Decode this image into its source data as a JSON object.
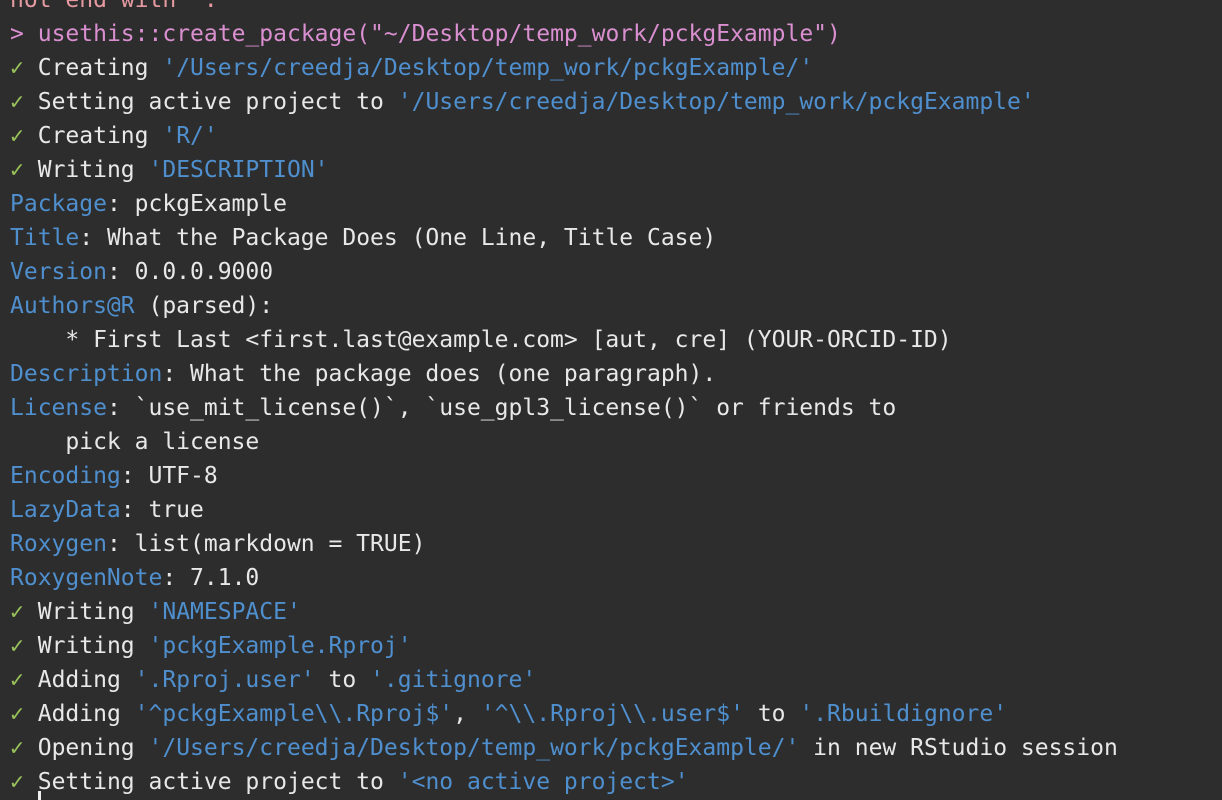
{
  "colors": {
    "background": "#2d2d2d",
    "text": "#e8e8e8",
    "command": "#d98fd0",
    "checkmark": "#98c15a",
    "highlight": "#4f8fce"
  },
  "console": {
    "top_partial": "not end with '.",
    "prompt": ">",
    "command": "usethis::create_package(\"~/Desktop/temp_work/pckgExample\")",
    "check_mark": "✓",
    "lines": {
      "l1_text": "Creating ",
      "l1_path": "'/Users/creedja/Desktop/temp_work/pckgExample/'",
      "l2_text": "Setting active project to ",
      "l2_path": "'/Users/creedja/Desktop/temp_work/pckgExample'",
      "l3_text": "Creating ",
      "l3_path": "'R/'",
      "l4_text": "Writing ",
      "l4_path": "'DESCRIPTION'",
      "pkg_key": "Package",
      "pkg_val": ": pckgExample",
      "title_key": "Title",
      "title_val": ": What the Package Does (One Line, Title Case)",
      "version_key": "Version",
      "version_val": ": 0.0.0.9000",
      "authors_key": "Authors@R",
      "authors_val": " (parsed):",
      "author_entry": "    * First Last <first.last@example.com> [aut, cre] (YOUR-ORCID-ID)",
      "desc_key": "Description",
      "desc_val": ": What the package does (one paragraph).",
      "license_key": "License",
      "license_val": ": `use_mit_license()`, `use_gpl3_license()` or friends to",
      "license_cont": "    pick a license",
      "encoding_key": "Encoding",
      "encoding_val": ": UTF-8",
      "lazy_key": "LazyData",
      "lazy_val": ": true",
      "roxygen_key": "Roxygen",
      "roxygen_val": ": list(markdown = TRUE)",
      "roxynote_key": "RoxygenNote",
      "roxynote_val": ": 7.1.0",
      "l5_text": "Writing ",
      "l5_path": "'NAMESPACE'",
      "l6_text": "Writing ",
      "l6_path": "'pckgExample.Rproj'",
      "l7_text": "Adding ",
      "l7_path": "'.Rproj.user'",
      "l7_to": " to ",
      "l7_target": "'.gitignore'",
      "l8_text": "Adding ",
      "l8_path1": "'^pckgExample\\\\.Rproj$'",
      "l8_sep": ", ",
      "l8_path2": "'^\\\\.Rproj\\\\.user$'",
      "l8_to": " to ",
      "l8_target": "'.Rbuildignore'",
      "l9_text": "Opening ",
      "l9_path": "'/Users/creedja/Desktop/temp_work/pckgExample/'",
      "l9_tail": " in new RStudio session",
      "l10_text": "Setting active project to ",
      "l10_path": "'<no active project>'"
    }
  }
}
